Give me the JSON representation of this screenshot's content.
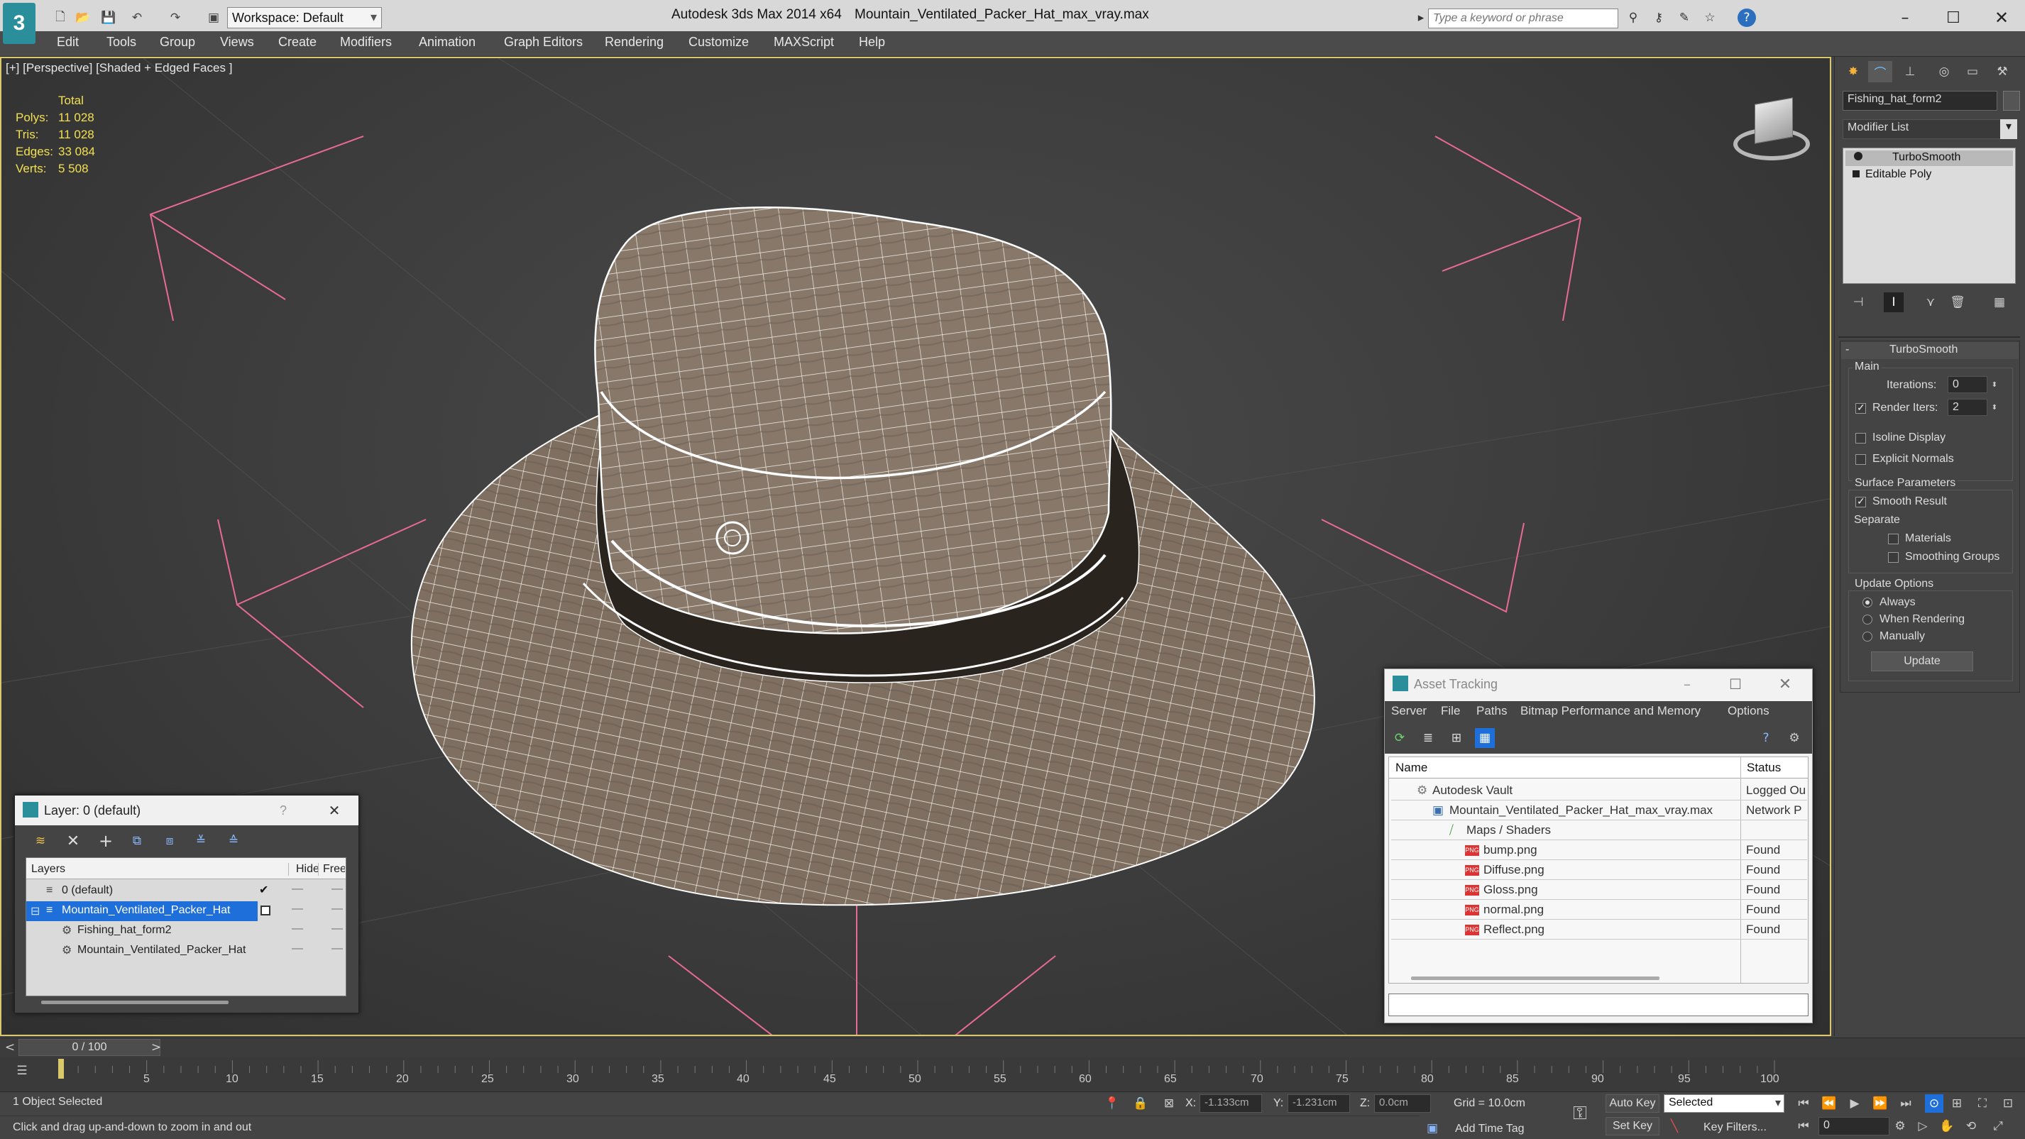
{
  "app": {
    "title": "Autodesk 3ds Max  2014 x64",
    "file": "Mountain_Ventilated_Packer_Hat_max_vray.max",
    "workspace": "Workspace: Default",
    "search_placeholder": "Type a keyword or phrase"
  },
  "menu": [
    "Edit",
    "Tools",
    "Group",
    "Views",
    "Create",
    "Modifiers",
    "Animation",
    "Graph Editors",
    "Rendering",
    "Customize",
    "MAXScript",
    "Help"
  ],
  "viewport": {
    "label": "[+] [Perspective] [Shaded + Edged Faces ]",
    "stats": {
      "total": "Total",
      "polys_label": "Polys:",
      "polys": "11 028",
      "tris_label": "Tris:",
      "tris": "11 028",
      "edges_label": "Edges:",
      "edges": "33 084",
      "verts_label": "Verts:",
      "verts": "5 508"
    }
  },
  "command_panel": {
    "object_name": "Fishing_hat_form2",
    "modifier_list": "Modifier List",
    "stack": [
      "TurboSmooth",
      "Editable Poly"
    ],
    "rollout_title": "TurboSmooth",
    "main_label": "Main",
    "iterations_label": "Iterations:",
    "iterations": "0",
    "render_iters_label": "Render Iters:",
    "render_iters": "2",
    "isoline": "Isoline Display",
    "explicit": "Explicit Normals",
    "surface_params": "Surface Parameters",
    "smooth_result": "Smooth Result",
    "separate": "Separate",
    "materials": "Materials",
    "smoothing_groups": "Smoothing Groups",
    "update_options": "Update Options",
    "always": "Always",
    "when_rendering": "When Rendering",
    "manually": "Manually",
    "update_btn": "Update"
  },
  "asset_tracking": {
    "title": "Asset Tracking",
    "menu": [
      "Server",
      "File",
      "Paths",
      "Bitmap Performance and Memory",
      "Options"
    ],
    "col_name": "Name",
    "col_status": "Status",
    "rows": [
      {
        "name": "Autodesk Vault",
        "status": "Logged Ou"
      },
      {
        "name": "Mountain_Ventilated_Packer_Hat_max_vray.max",
        "status": "Network P"
      },
      {
        "name": "Maps / Shaders",
        "status": ""
      },
      {
        "name": "bump.png",
        "status": "Found"
      },
      {
        "name": "Diffuse.png",
        "status": "Found"
      },
      {
        "name": "Gloss.png",
        "status": "Found"
      },
      {
        "name": "normal.png",
        "status": "Found"
      },
      {
        "name": "Reflect.png",
        "status": "Found"
      }
    ],
    "png_tag": "PNG"
  },
  "layers": {
    "title": "Layer: 0 (default)",
    "help": "?",
    "col_layers": "Layers",
    "col_hide": "Hide",
    "col_freeze": "Free",
    "rows": [
      "0 (default)",
      "Mountain_Ventilated_Packer_Hat",
      "Fishing_hat_form2",
      "Mountain_Ventilated_Packer_Hat"
    ]
  },
  "timeline": {
    "frame": "0 / 100",
    "ticks": [
      "5",
      "10",
      "15",
      "20",
      "25",
      "30",
      "35",
      "40",
      "45",
      "50",
      "55",
      "60",
      "65",
      "70",
      "75",
      "80",
      "85",
      "90",
      "95",
      "100"
    ]
  },
  "status": {
    "selected": "1 Object Selected",
    "prompt": "Click and drag up-and-down to zoom in and out",
    "x_label": "X:",
    "x": "-1.133cm",
    "y_label": "Y:",
    "y": "-1.231cm",
    "z_label": "Z:",
    "z": "0.0cm",
    "grid": "Grid = 10.0cm",
    "auto_key": "Auto Key",
    "set_key": "Set Key",
    "selected_dd": "Selected",
    "key_filters": "Key Filters...",
    "add_time_tag": "Add Time Tag",
    "frame_field": "0"
  },
  "colors": {
    "accent": "#1e6fd9",
    "viewport_bg": "#3b3b3b",
    "wire": "#ffffff",
    "hat": "#8a7a68"
  }
}
